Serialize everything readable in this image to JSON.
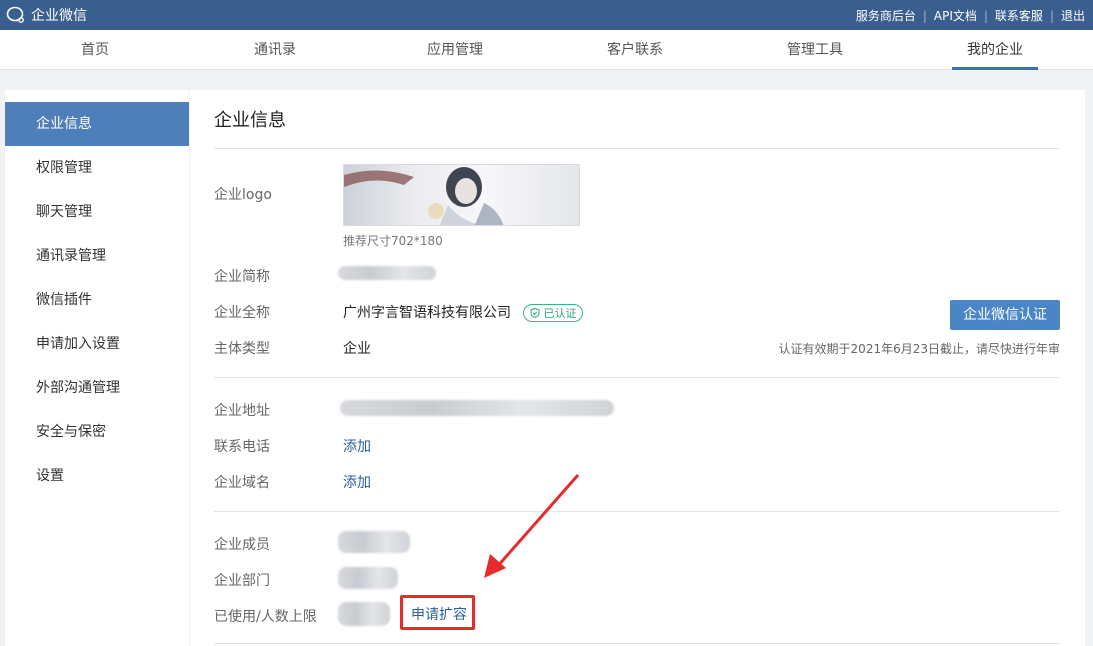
{
  "app": {
    "title": "企业微信"
  },
  "top_links": [
    "服务商后台",
    "API文档",
    "联系客服",
    "退出"
  ],
  "tabs": [
    "首页",
    "通讯录",
    "应用管理",
    "客户联系",
    "管理工具",
    "我的企业"
  ],
  "active_tab": "我的企业",
  "sidebar": [
    "企业信息",
    "权限管理",
    "聊天管理",
    "通讯录管理",
    "微信插件",
    "申请加入设置",
    "外部沟通管理",
    "安全与保密",
    "设置"
  ],
  "main": {
    "title": "企业信息",
    "logo_label": "企业logo",
    "logo_hint": "推荐尺寸702*180",
    "short_name_label": "企业简称",
    "full_name_label": "企业全称",
    "full_name_value": "广州字言智语科技有限公司",
    "verified_badge": "已认证",
    "type_label": "主体类型",
    "type_value": "企业",
    "verify_button": "企业微信认证",
    "verify_note": "认证有效期于2021年6月23日截止，请尽快进行年审",
    "address_label": "企业地址",
    "phone_label": "联系电话",
    "phone_value": "添加",
    "domain_label": "企业域名",
    "domain_value": "添加",
    "members_label": "企业成员",
    "departments_label": "企业部门",
    "limit_label": "已使用/人数上限",
    "expand_link": "申请扩容"
  },
  "colors": {
    "topbar": "#3a5f8f",
    "accent": "#4a86c7",
    "highlight": "#e52b2b"
  }
}
